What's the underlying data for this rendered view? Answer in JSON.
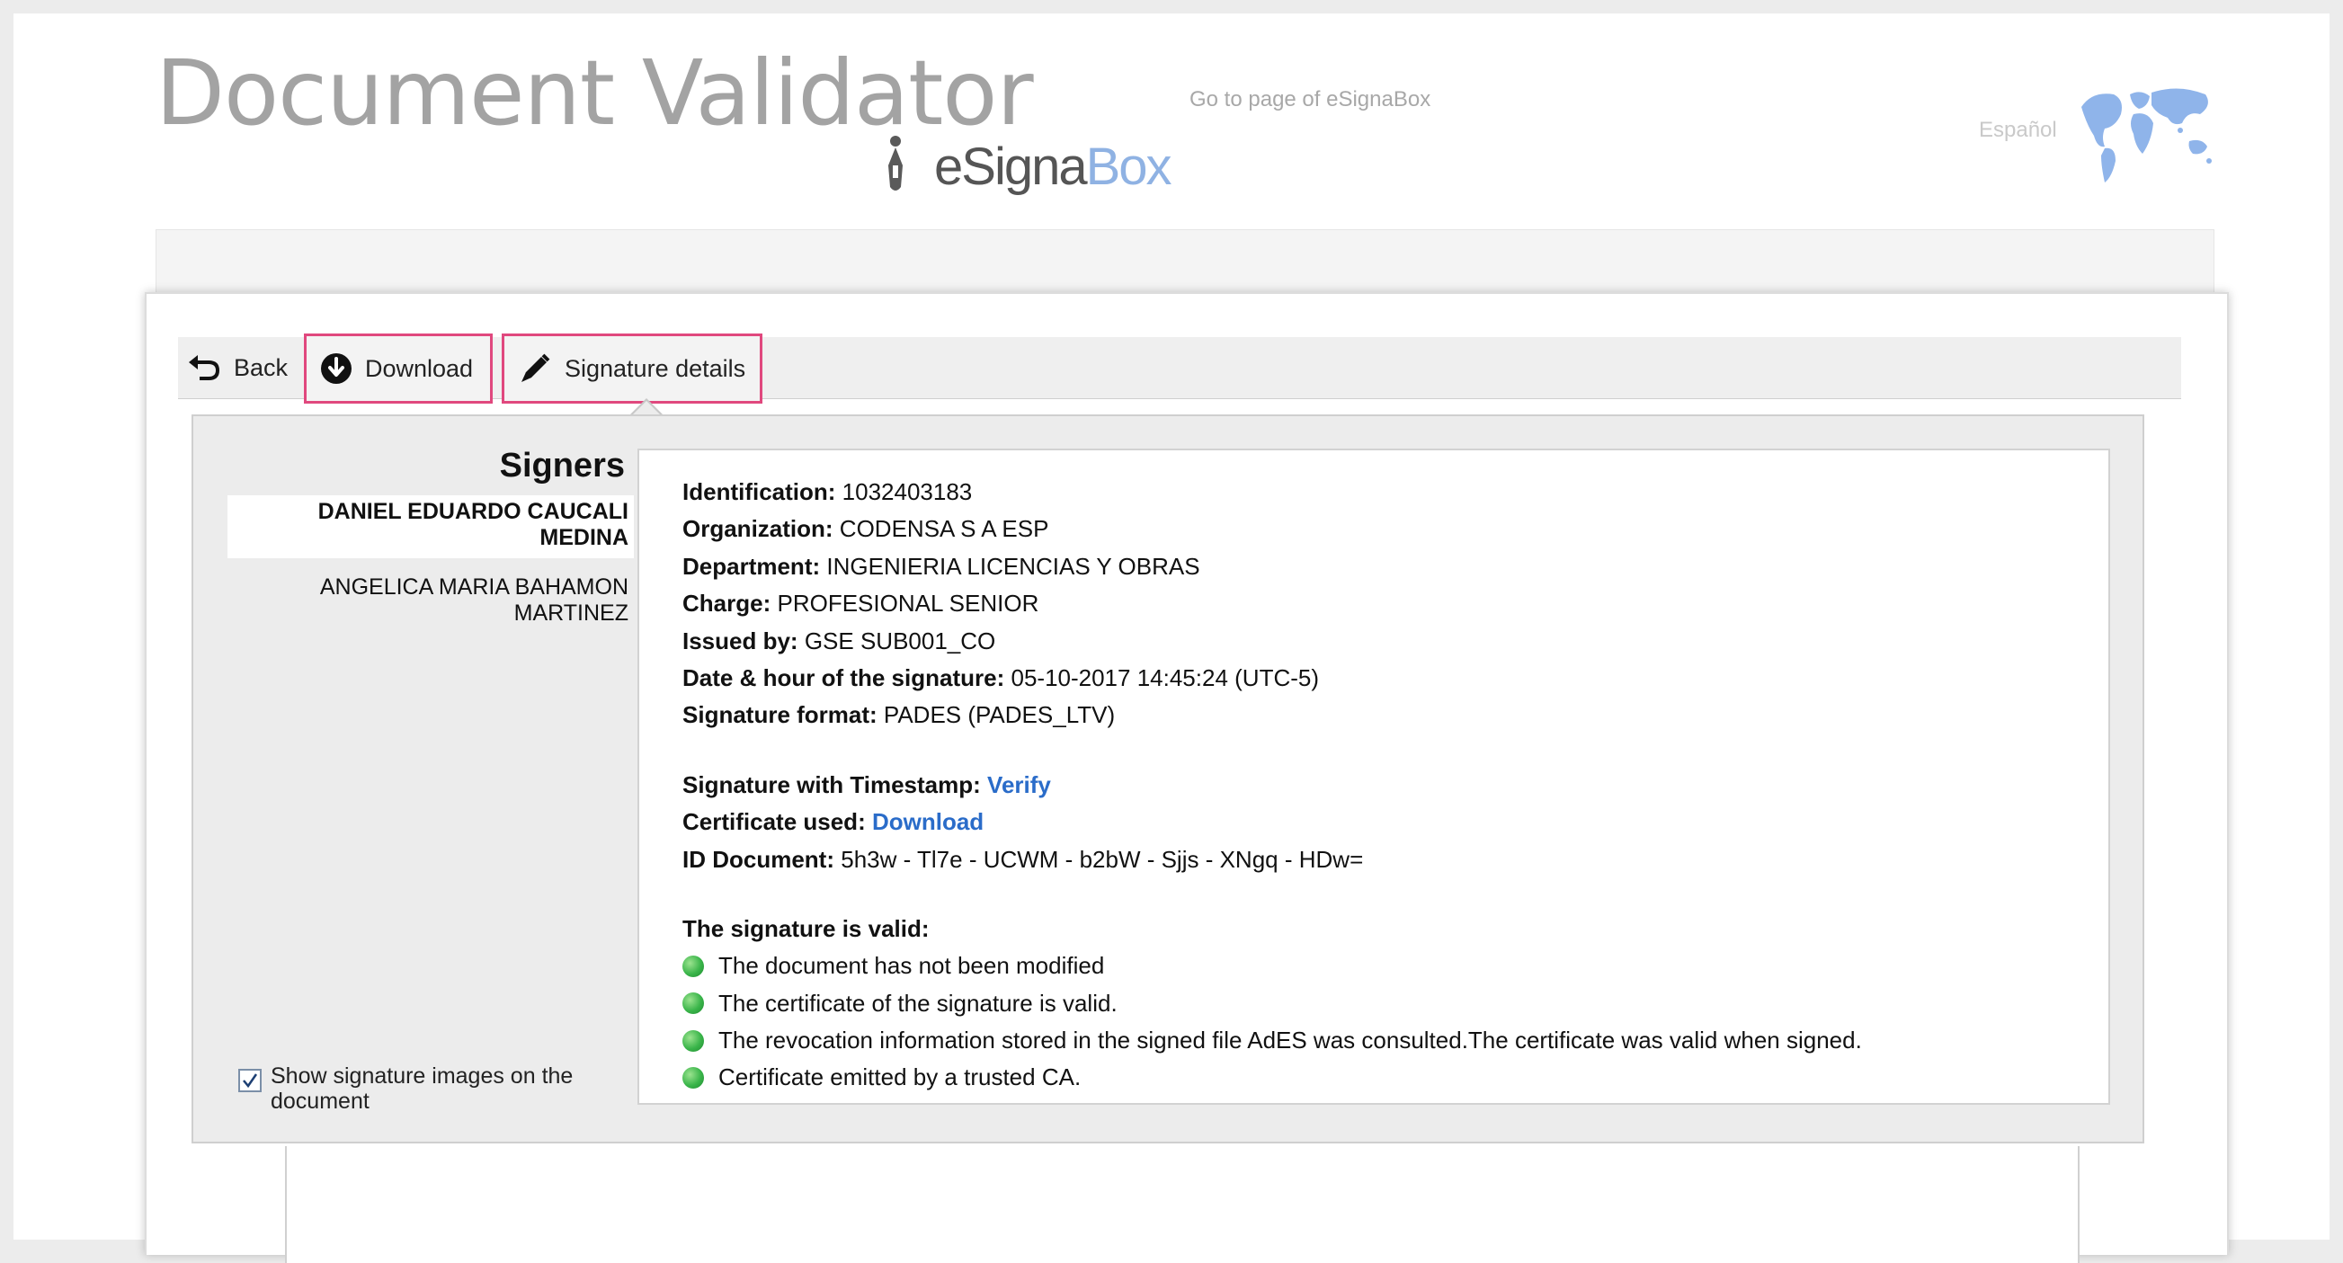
{
  "header": {
    "title": "Document Validator",
    "brand_main": "eSigna",
    "brand_accent": "Box",
    "goto_link": "Go to page of eSignaBox",
    "language_link": "Español"
  },
  "toolbar": {
    "back_label": "Back",
    "download_label": "Download",
    "signature_details_label": "Signature details"
  },
  "signers": {
    "heading": "Signers",
    "selected": {
      "line1": "DANIEL EDUARDO CAUCALI",
      "line2": "MEDINA"
    },
    "other": {
      "line1": "ANGELICA MARIA BAHAMON",
      "line2": "MARTINEZ"
    },
    "show_images_line1": "Show signature images on the",
    "show_images_line2": "document",
    "show_images_checked": true
  },
  "details": {
    "identification_label": "Identification:",
    "identification_value": "1032403183",
    "organization_label": "Organization:",
    "organization_value": "CODENSA S A ESP",
    "department_label": "Department:",
    "department_value": "INGENIERIA LICENCIAS Y OBRAS",
    "charge_label": "Charge:",
    "charge_value": "PROFESIONAL SENIOR",
    "issued_label": "Issued by:",
    "issued_value": "GSE SUB001_CO",
    "date_label": "Date & hour of the signature:",
    "date_value": "05-10-2017 14:45:24 (UTC-5)",
    "format_label": "Signature format:",
    "format_value": "PADES (PADES_LTV)",
    "timestamp_label": "Signature with Timestamp:",
    "timestamp_link": "Verify",
    "certificate_label": "Certificate used:",
    "certificate_link": "Download",
    "id_doc_label": "ID Document:",
    "id_doc_value": "5h3w - Tl7e - UCWM - b2bW - Sjjs - XNgq - HDw=",
    "valid_heading": "The signature is valid:",
    "checks": [
      "The document has not been modified",
      "The certificate of the signature is valid.",
      "The revocation information stored in the signed file AdES was consulted.The certificate was valid when signed.",
      "Certificate emitted by a trusted CA."
    ]
  },
  "colors": {
    "highlight": "#e0487e",
    "link": "#2a6cc9",
    "valid_dot": "#3ab54a"
  }
}
